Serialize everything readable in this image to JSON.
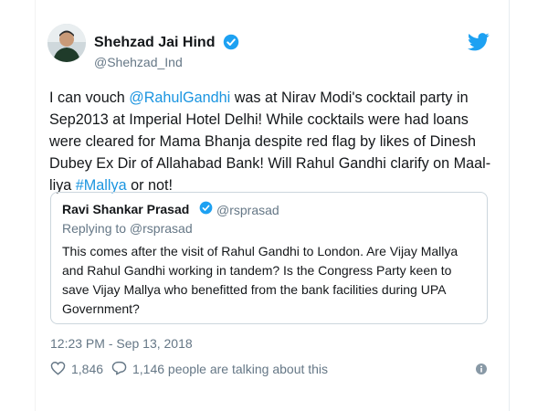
{
  "author": {
    "name": "Shehzad Jai Hind",
    "handle": "@Shehzad_Ind",
    "avatar_icon": "avatar-photo",
    "verified_icon": "verified-badge-icon"
  },
  "brand_icon": "twitter-bird-icon",
  "colors": {
    "link": "#1b95e0",
    "muted": "#657786",
    "text": "#14171a",
    "border": "#ccd6dd"
  },
  "tweet": {
    "lines": [
      [
        "I can vouch ",
        "@RahulGandhi",
        " was at Nirav Modi's cocktail party in"
      ],
      [
        "Sep2013 at Imperial Hotel Delhi! While cocktails were had loans"
      ],
      [
        "were cleared for Mama Bhanja despite red flag by likes of Dinesh"
      ],
      [
        "Dubey Ex Dir of Allahabad Bank! Will Rahul Gandhi clarify on Maal-"
      ],
      [
        "liya ",
        "#Mallya",
        " or not!"
      ]
    ]
  },
  "quoted": {
    "name": "Ravi Shankar Prasad",
    "handle": "@rsprasad",
    "replying_to": "Replying to @rsprasad",
    "lines": [
      "This comes after the visit of Rahul Gandhi to London. Are Vijay Mallya",
      "and Rahul Gandhi working in tandem? Is the Congress Party keen to",
      "save Vijay Mallya who benefitted from the bank facilities during UPA",
      "Government?"
    ]
  },
  "timestamp": "12:23 PM - Sep 13, 2018",
  "actions": {
    "like_count": "1,846",
    "talking_text": "1,146 people are talking about this",
    "like_icon": "heart-icon",
    "reply_icon": "comment-bubble-icon",
    "info_icon": "info-icon"
  }
}
